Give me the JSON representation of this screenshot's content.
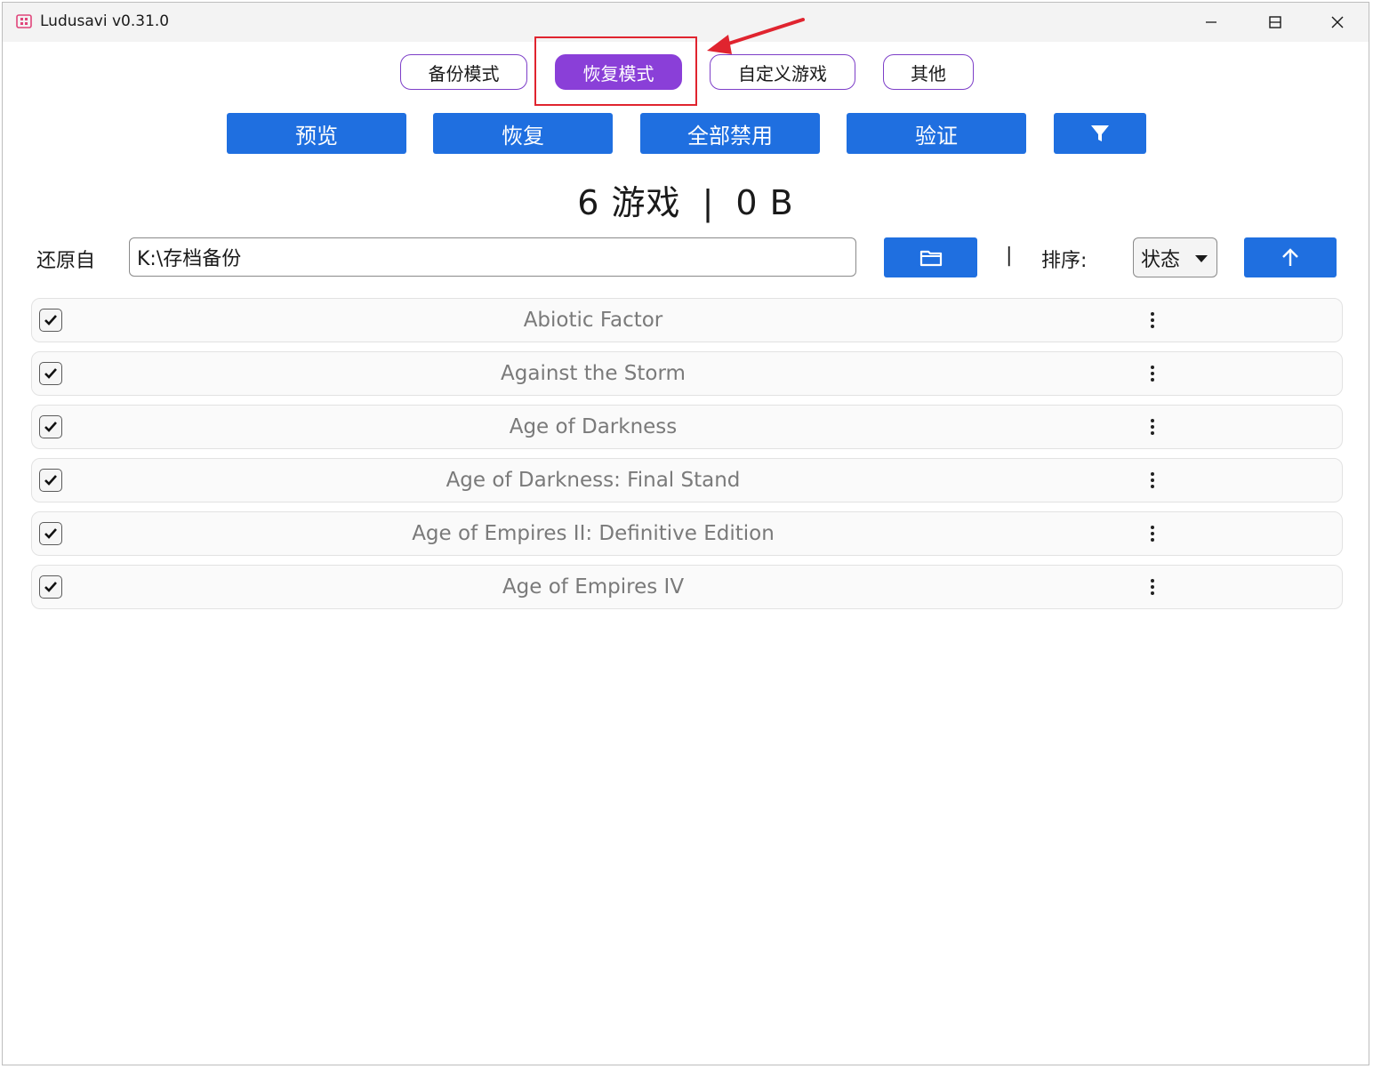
{
  "window": {
    "title": "Ludusavi v0.31.0",
    "app_icon": "ludusavi-app-icon"
  },
  "mode_tabs": [
    {
      "label": "备份模式",
      "active": false
    },
    {
      "label": "恢复模式",
      "active": true
    },
    {
      "label": "自定义游戏",
      "active": false
    },
    {
      "label": "其他",
      "active": false
    }
  ],
  "actions": {
    "preview": "预览",
    "restore": "恢复",
    "disable_all": "全部禁用",
    "validate": "验证",
    "filter_icon": "filter-icon"
  },
  "summary": {
    "games": "6 游戏",
    "separator": "|",
    "size": "0 B"
  },
  "restore_from": {
    "label": "还原自",
    "value": "K:\\存档备份",
    "browse_icon": "folder-icon"
  },
  "sort": {
    "pipe": "|",
    "label": "排序:",
    "selected": "状态",
    "direction_icon": "arrow-up-icon"
  },
  "games": [
    {
      "name": "Abiotic Factor",
      "checked": true
    },
    {
      "name": "Against the Storm",
      "checked": true
    },
    {
      "name": "Age of Darkness",
      "checked": true
    },
    {
      "name": "Age of Darkness: Final Stand",
      "checked": true
    },
    {
      "name": "Age of Empires II: Definitive Edition",
      "checked": true
    },
    {
      "name": "Age of Empires IV",
      "checked": true
    }
  ],
  "colors": {
    "accent_purple": "#8a3fd8",
    "button_blue": "#1f6fe0",
    "annotation_red": "#e0242f"
  }
}
